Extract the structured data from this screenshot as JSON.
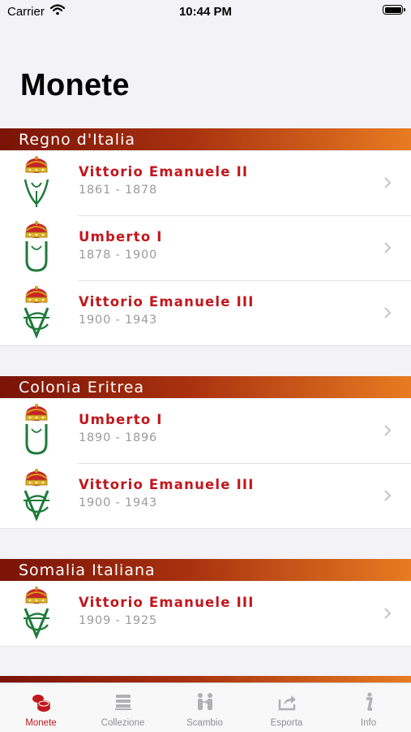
{
  "status_bar": {
    "carrier": "Carrier",
    "time": "10:44 PM"
  },
  "title": "Monete",
  "sections": [
    {
      "header": "Regno d'Italia",
      "rows": [
        {
          "name": "Vittorio Emanuele II",
          "years": "1861 - 1878",
          "emblem": "crown-ve-monogram-icon"
        },
        {
          "name": "Umberto I",
          "years": "1878 - 1900",
          "emblem": "crown-u-monogram-icon"
        },
        {
          "name": "Vittorio Emanuele III",
          "years": "1900 - 1943",
          "emblem": "crown-ve3-monogram-icon"
        }
      ]
    },
    {
      "header": "Colonia Eritrea",
      "rows": [
        {
          "name": "Umberto I",
          "years": "1890 - 1896",
          "emblem": "crown-u-monogram-icon"
        },
        {
          "name": "Vittorio Emanuele III",
          "years": "1900 - 1943",
          "emblem": "crown-ve3-monogram-icon"
        }
      ]
    },
    {
      "header": "Somalia Italiana",
      "rows": [
        {
          "name": "Vittorio Emanuele III",
          "years": "1909 - 1925",
          "emblem": "crown-ve3-monogram-icon"
        }
      ]
    }
  ],
  "tabs": [
    {
      "label": "Monete",
      "icon": "coins-icon",
      "active": true
    },
    {
      "label": "Collezione",
      "icon": "stack-icon",
      "active": false
    },
    {
      "label": "Scambio",
      "icon": "exchange-icon",
      "active": false
    },
    {
      "label": "Esporta",
      "icon": "share-icon",
      "active": false
    },
    {
      "label": "Info",
      "icon": "info-icon",
      "active": false
    }
  ],
  "colors": {
    "accent": "#c0181d",
    "header_start": "#7a1408",
    "header_end": "#e87b22",
    "emblem_green": "#1f7a3a"
  }
}
